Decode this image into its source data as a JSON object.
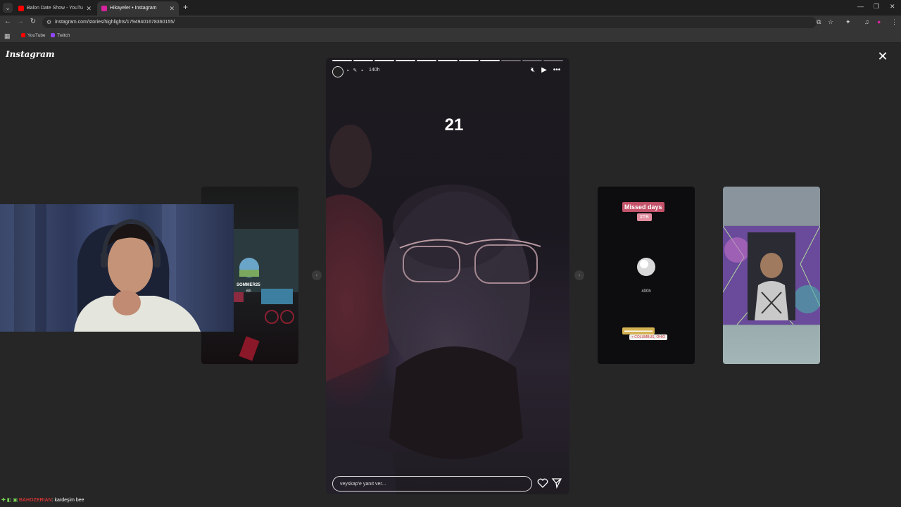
{
  "browser": {
    "tabs": [
      {
        "title": "Balon Date Show - YouTube",
        "favicon_color": "#ff0000",
        "active": false
      },
      {
        "title": "Hikayeler • Instagram",
        "favicon_color": "#d6249f",
        "active": true
      }
    ],
    "new_tab_label": "+",
    "url": "instagram.com/stories/highlights/17949401678360155/",
    "bookmarks": [
      {
        "label": "YouTube",
        "color": "#ff0000"
      },
      {
        "label": "Twitch",
        "color": "#9146ff"
      }
    ]
  },
  "instagram": {
    "logo": "Instagram",
    "story": {
      "time_ago": "140h",
      "number_sticker": "21",
      "reply_placeholder": "veyskap'e yanıt ver...",
      "progress_total": 11,
      "progress_done": 8
    },
    "previews": {
      "left": {
        "name": "SOMMER25",
        "time_ago": "6h"
      },
      "right1": {
        "title": "Missed days",
        "tag": "#TB",
        "time_ago": "400h",
        "location": "COLUMBUS, OHIO"
      }
    }
  },
  "chat": {
    "badges": "✚ ◧ ▣",
    "username": "BAHOZERIAN",
    "message": ": kardeşim bee"
  },
  "colors": {
    "page_background": "#262626",
    "pink_sticker": "#c3536a",
    "chat_user": "#cc3333"
  }
}
